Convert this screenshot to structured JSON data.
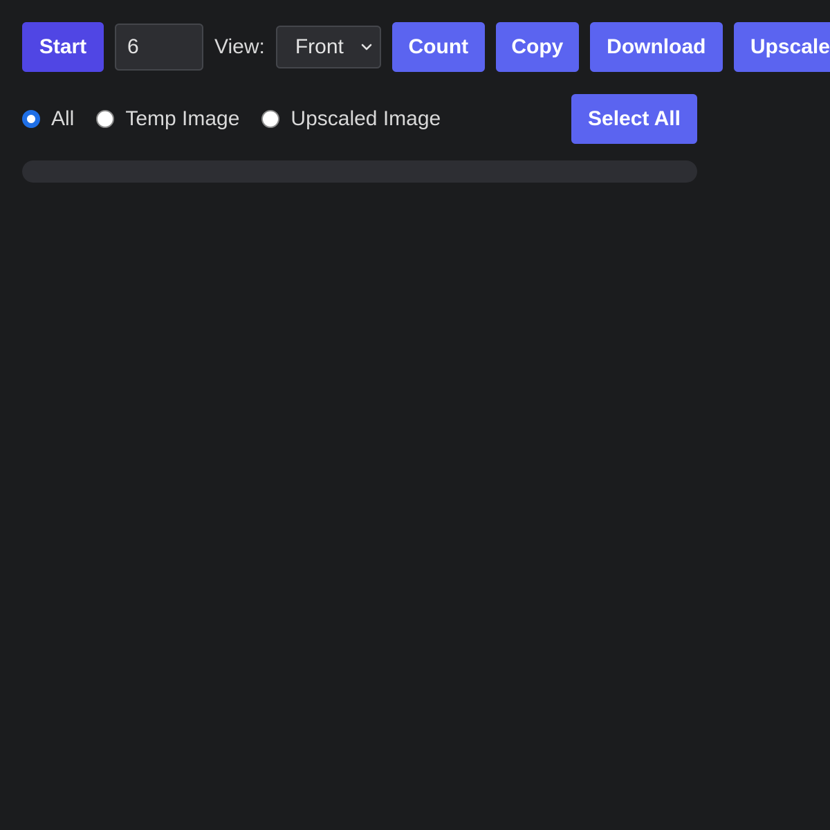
{
  "toolbar": {
    "start_label": "Start",
    "count_input_value": "6",
    "view_label": "View:",
    "view_select_value": "Front",
    "count_label": "Count",
    "copy_label": "Copy",
    "download_label": "Download",
    "upscale_label": "Upscale"
  },
  "filter": {
    "options": [
      {
        "label": "All",
        "checked": true
      },
      {
        "label": "Temp Image",
        "checked": false
      },
      {
        "label": "Upscaled Image",
        "checked": false
      }
    ],
    "select_all_label": "Select All"
  },
  "progress": {
    "value_percent": 0
  },
  "colors": {
    "background": "#1b1c1e",
    "start_button": "#5046e4",
    "action_button": "#5b64f0",
    "radio_checked": "#1f6fe6",
    "progress_track": "#2d2e33"
  }
}
